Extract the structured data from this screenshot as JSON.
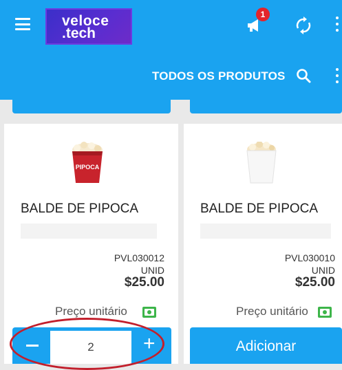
{
  "header": {
    "logo_line1": "veloce",
    "logo_line2": ".tech",
    "notification_count": "1",
    "menu_icon": "hamburger-icon",
    "notification_icon": "megaphone-icon",
    "sync_icon": "sync-icon",
    "more_icon": "more-vert-icon"
  },
  "subheader": {
    "title": "TODOS OS PRODUTOS",
    "search_icon": "search-icon",
    "more_icon": "more-vert-icon"
  },
  "products": [
    {
      "name": "BALDE DE PIPOCA",
      "image_label": "PIPOCA",
      "code": "PVL030012",
      "unit": "UNID",
      "price": "$25.00",
      "unit_price_label": "Preço unitário",
      "quantity": "2"
    },
    {
      "name": "BALDE DE PIPOCA",
      "code": "PVL030010",
      "unit": "UNID",
      "price": "$25.00",
      "unit_price_label": "Preço unitário",
      "add_label": "Adicionar"
    }
  ],
  "colors": {
    "primary": "#1aa3f0",
    "badge": "#e3242b",
    "highlight_circle": "#c21f2c",
    "cash_icon": "#3db54a"
  }
}
